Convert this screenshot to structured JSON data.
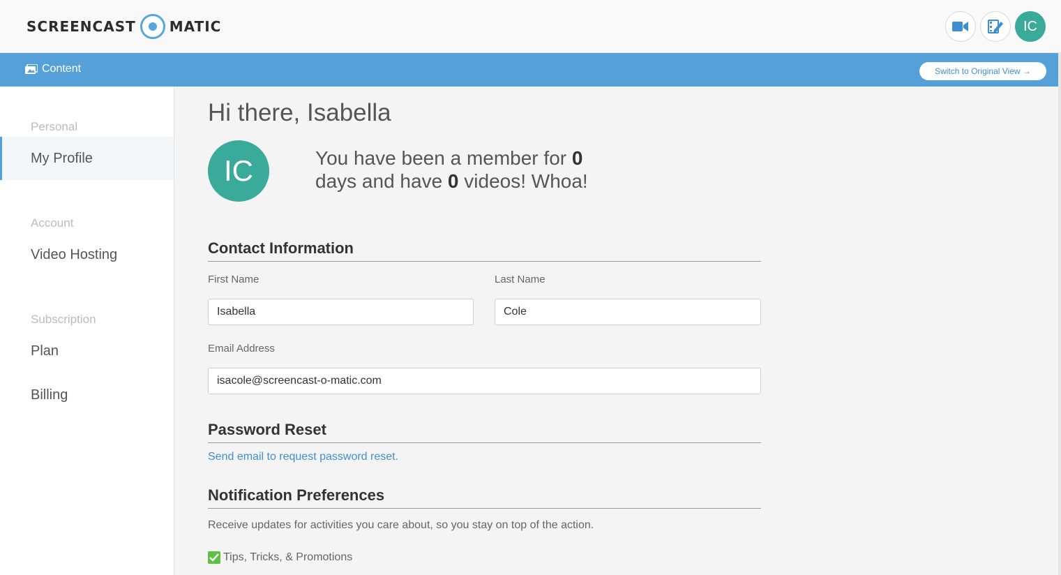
{
  "header": {
    "logo_left": "SCREENCAST",
    "logo_right": "MATIC",
    "avatar_initials": "IC",
    "icons": [
      "video-camera-icon",
      "edit-video-icon"
    ]
  },
  "bluebar": {
    "content_label": "Content",
    "switch_label": "Switch to Original View →"
  },
  "sidebar": {
    "sections": [
      {
        "heading": "Personal",
        "items": [
          "My Profile"
        ]
      },
      {
        "heading": "Account",
        "items": [
          "Video Hosting"
        ]
      },
      {
        "heading": "Subscription",
        "items": [
          "Plan",
          "Billing"
        ]
      }
    ],
    "active_item": "My Profile"
  },
  "main": {
    "greeting": "Hi there, Isabella",
    "avatar_initials": "IC",
    "member_line1_prefix": "You have been a member for",
    "member_days": "0",
    "member_line2_prefix": "days and have",
    "member_videos": "0",
    "member_line2_suffix": "videos! Whoa!",
    "contact": {
      "title": "Contact Information",
      "first_name_label": "First Name",
      "first_name_value": "Isabella",
      "last_name_label": "Last Name",
      "last_name_value": "Cole",
      "email_label": "Email Address",
      "email_value": "isacole@screencast-o-matic.com"
    },
    "password": {
      "title": "Password Reset",
      "link": "Send email to request password reset."
    },
    "notifications": {
      "title": "Notification Preferences",
      "description": "Receive updates for activities you care about, so you stay on top of the action.",
      "option_label": "Tips, Tricks, & Promotions",
      "option_checked": true
    }
  },
  "colors": {
    "brand_blue": "#55a0d9",
    "avatar_teal": "#3aaa9a",
    "check_green": "#5ec044"
  }
}
